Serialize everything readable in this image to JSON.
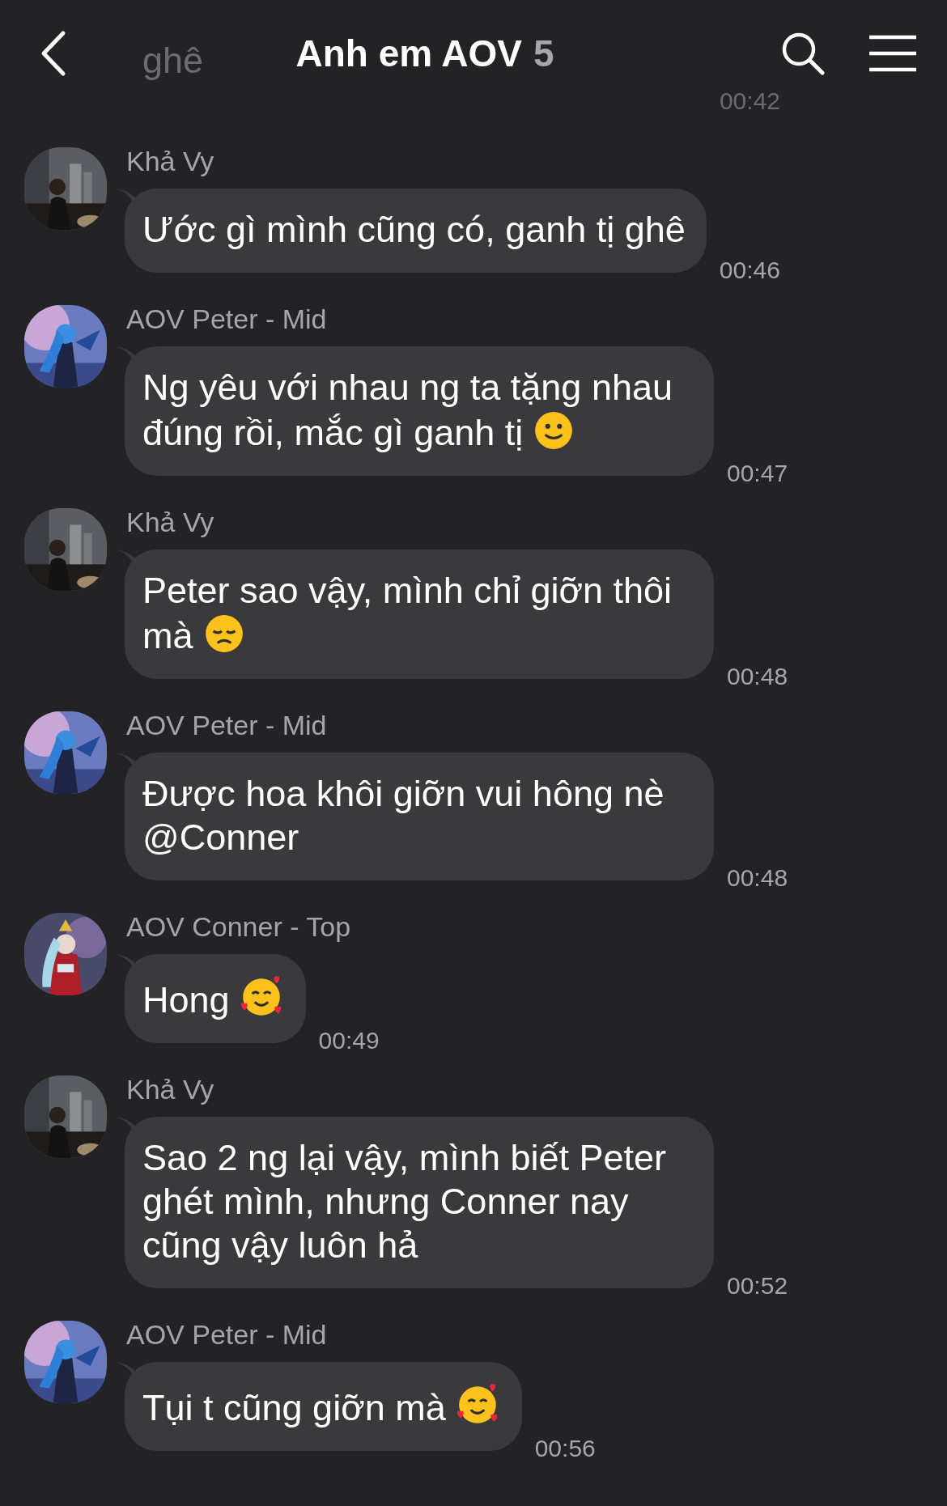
{
  "header": {
    "title": "Anh em AOV",
    "member_count": "5"
  },
  "messages": [
    {
      "text": "ghê",
      "time": "00:42",
      "faded": true
    },
    {
      "sender": "Khả Vy",
      "text": "Ước gì mình cũng có, ganh tị ghê",
      "time": "00:46",
      "faded": false
    },
    {
      "sender": "AOV Peter - Mid",
      "text": "Ng yêu với nhau ng ta tặng nhau đúng rồi, mắc gì ganh tị",
      "emoji": {
        "kind": "smile"
      },
      "time": "00:47",
      "faded": false
    },
    {
      "sender": "Khả Vy",
      "text": "Peter sao vậy, mình chỉ giỡn thôi mà",
      "emoji": {
        "kind": "sad"
      },
      "time": "00:48",
      "faded": false
    },
    {
      "sender": "AOV Peter - Mid",
      "text": "Được hoa khôi giỡn vui hông nè @Conner",
      "time": "00:48",
      "faded": false
    },
    {
      "sender": "AOV Conner - Top",
      "text": "Hong",
      "emoji": {
        "kind": "hearts"
      },
      "time": "00:49",
      "faded": false
    },
    {
      "sender": "Khả Vy",
      "text": "Sao 2 ng lại vậy, mình biết Peter ghét mình, nhưng Conner nay cũng vậy luôn hả",
      "time": "00:52",
      "faded": false
    },
    {
      "sender": "AOV Peter - Mid",
      "text": "Tụi t cũng giỡn mà",
      "emoji": {
        "kind": "hearts"
      },
      "time": "00:56",
      "faded": false
    }
  ]
}
